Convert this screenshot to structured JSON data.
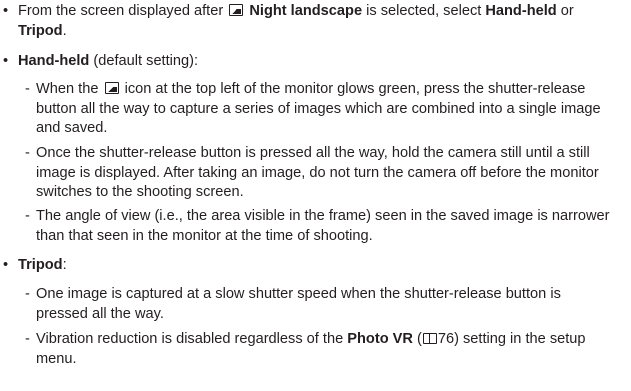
{
  "bullet_char": "•",
  "dash_char": "-",
  "b1": {
    "pre": "From the screen displayed after ",
    "name": "Night landscape",
    "mid": " is selected, select ",
    "opt1": "Hand-held",
    "or": " or ",
    "opt2": "Tripod",
    "end": "."
  },
  "b2": {
    "title": "Hand-held",
    "suffix": " (default setting):",
    "s1_pre": "When the ",
    "s1_post": " icon at the top left of the monitor glows green, press the shutter-release button all the way to capture a series of images which are combined into a single image and saved.",
    "s2": "Once the shutter-release button is pressed all the way, hold the camera still until a still image is displayed. After taking an image, do not turn the camera off before the monitor switches to the shooting screen.",
    "s3": "The angle of view (i.e., the area visible in the frame) seen in the saved image is narrower than that seen in the monitor at the time of shooting."
  },
  "b3": {
    "title": "Tripod",
    "suffix": ":",
    "s1": "One image is captured at a slow shutter speed when the shutter-release button is pressed all the way.",
    "s2_pre": "Vibration reduction is disabled regardless of the ",
    "s2_bold": "Photo VR",
    "s2_open": " (",
    "s2_page": "76",
    "s2_post": ") setting in the setup menu."
  },
  "icons": [
    "night-landscape-icon",
    "book-reference-icon"
  ]
}
